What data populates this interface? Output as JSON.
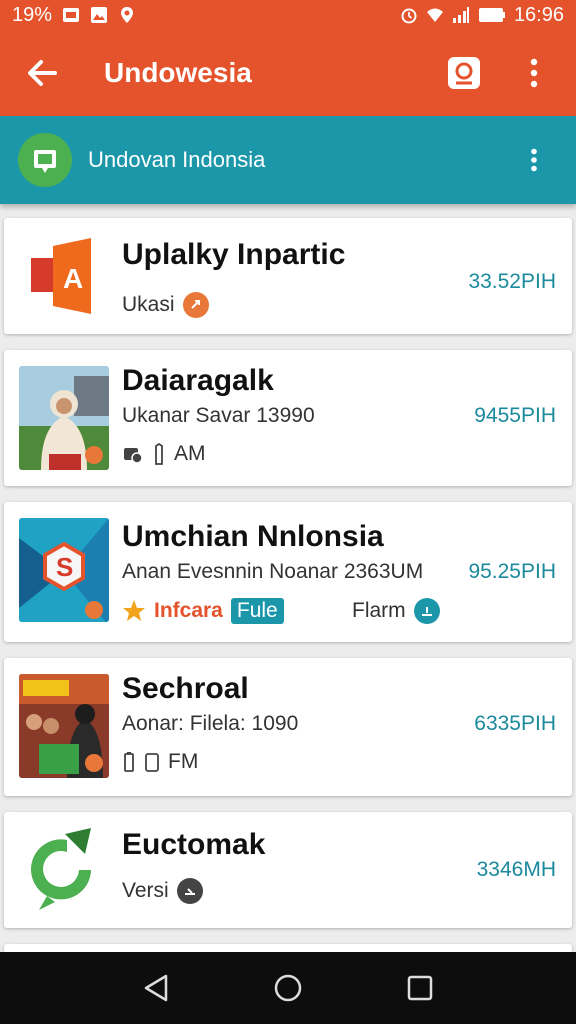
{
  "status_bar": {
    "battery_left": "19%",
    "time": "16:96"
  },
  "app_bar": {
    "title": "Undowesia",
    "back_icon": "arrow-back-icon",
    "search_icon": "search-icon",
    "menu_icon": "more-vert-icon"
  },
  "sub_bar": {
    "title": "Undovan Indonsia",
    "menu_icon": "more-vert-icon"
  },
  "items": [
    {
      "title": "Uplalky Inpartic",
      "subtitle": "Ukasi",
      "price": "33.52PIH"
    },
    {
      "title": "Daiaragalk",
      "subtitle": "Ukanar Savar 13990",
      "meta": "AM",
      "price": "9455PIH"
    },
    {
      "title": "Umchian Nnlonsia",
      "subtitle": "Anan Evesnnin Noanar 2363UM",
      "tag_label": "Infcara",
      "tag_chip": "Fule",
      "right_label": "Flarm",
      "price": "95.25PIH"
    },
    {
      "title": "Sechroal",
      "subtitle": "Aonar: Filela: 1090",
      "meta": "FM",
      "price": "6335PIH"
    },
    {
      "title": "Euctomak",
      "subtitle": "Versi",
      "price": "3346MH"
    }
  ],
  "nav": {
    "back": "nav-back-icon",
    "home": "nav-home-icon",
    "recents": "nav-recents-icon"
  },
  "colors": {
    "primary": "#e5532c",
    "secondary": "#1b97a9",
    "price": "#1b8a9c"
  }
}
